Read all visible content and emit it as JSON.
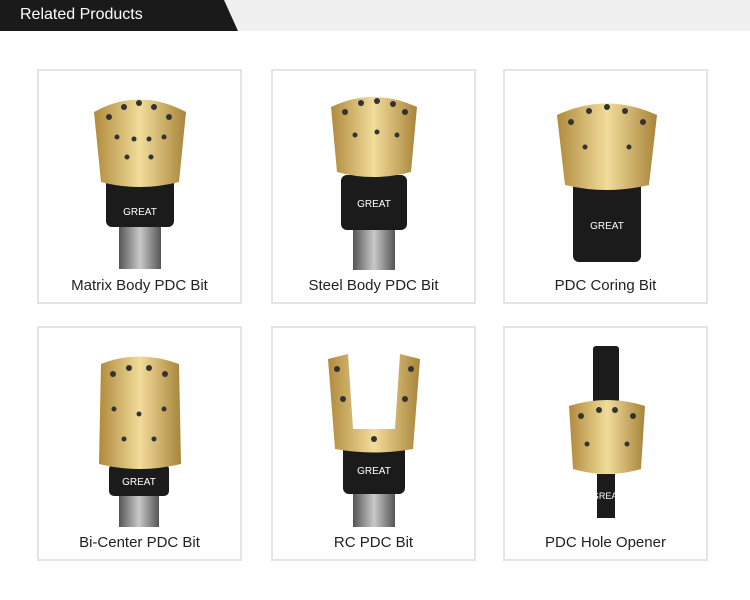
{
  "header": {
    "title": "Related Products"
  },
  "products": [
    {
      "label": "Matrix Body PDC Bit",
      "brand": "GREAT"
    },
    {
      "label": "Steel Body PDC Bit",
      "brand": "GREAT"
    },
    {
      "label": "PDC Coring Bit",
      "brand": "GREAT"
    },
    {
      "label": "Bi-Center PDC Bit",
      "brand": "GREAT"
    },
    {
      "label": "RC PDC Bit",
      "brand": "GREAT"
    },
    {
      "label": "PDC Hole Opener",
      "brand": "GREAT"
    }
  ],
  "colors": {
    "gold": "#d9b96a",
    "body": "#1b1b1b",
    "steel": "#8a8a8a",
    "header": "#1a1a1a"
  }
}
